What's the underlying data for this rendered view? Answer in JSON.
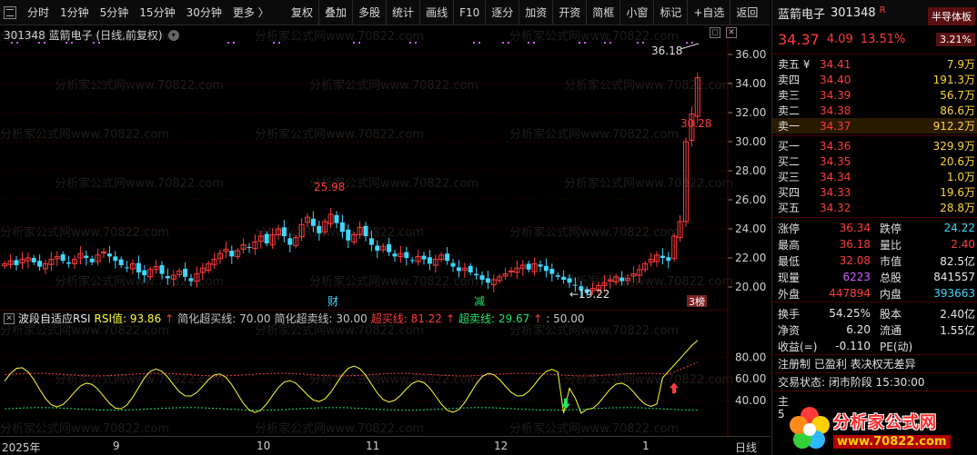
{
  "toolbar": {
    "left": [
      "分时",
      "1分钟",
      "5分钟",
      "15分钟",
      "30分钟",
      "更多 〉"
    ],
    "right": [
      "复权",
      "叠加",
      "多股",
      "统计",
      "画线",
      "F10",
      "逐分",
      "加资",
      "开资",
      "简框",
      "小窗",
      "标记",
      "+自选",
      "返回"
    ]
  },
  "chart": {
    "title": "301348 蓝箭电子 (日线,前复权)",
    "y_ticks": [
      "36.00",
      "34.00",
      "32.00",
      "30.00",
      "28.00",
      "26.00",
      "24.00",
      "22.00",
      "20.00"
    ],
    "annotations": {
      "high": "36.18",
      "peak2": "30.28",
      "mid": "25.98",
      "low": "←19.22"
    },
    "events": {
      "cai": "财",
      "jian": "减",
      "bang": "3榜"
    },
    "watermark": "分析家公式网www.70822.com"
  },
  "indicator": {
    "name": "波段自适应RSI",
    "rsi_label": "RSI值: 93.86",
    "simp_over_buy": "简化超买线: 70.00",
    "simp_over_sell": "简化超卖线: 30.00",
    "over_buy": "超买线: 81.22",
    "over_sell": "超卖线: 29.67",
    "mid": ": 50.00",
    "y_ticks": [
      "80.00",
      "60.00",
      "40.00"
    ]
  },
  "xaxis": {
    "labels": [
      "2025年",
      "9",
      "10",
      "11",
      "12",
      "1"
    ],
    "period": "日线"
  },
  "chart_data": {
    "type": "candlestick",
    "ylim": [
      19,
      37
    ],
    "closes": [
      21.6,
      21.8,
      21.5,
      21.9,
      22.0,
      21.7,
      21.4,
      21.6,
      21.9,
      22.1,
      21.8,
      21.6,
      21.9,
      22.3,
      22.0,
      21.7,
      22.2,
      22.4,
      22.1,
      21.8,
      21.5,
      21.3,
      21.6,
      21.0,
      20.8,
      21.2,
      21.4,
      20.9,
      20.6,
      20.8,
      21.1,
      20.7,
      20.4,
      20.9,
      21.3,
      21.6,
      21.9,
      22.3,
      22.6,
      22.1,
      22.5,
      22.9,
      22.7,
      23.1,
      23.5,
      23.0,
      23.6,
      24.0,
      23.5,
      22.9,
      23.4,
      24.3,
      24.8,
      24.2,
      23.7,
      24.5,
      25.0,
      24.4,
      23.8,
      23.2,
      23.6,
      24.1,
      23.5,
      22.9,
      22.5,
      22.8,
      22.4,
      22.1,
      22.3,
      22.0,
      21.8,
      22.1,
      21.9,
      21.6,
      21.9,
      22.2,
      21.8,
      21.4,
      21.1,
      21.3,
      21.0,
      20.8,
      20.5,
      20.3,
      20.5,
      20.7,
      20.9,
      21.1,
      21.3,
      21.5,
      21.2,
      21.6,
      21.4,
      21.1,
      20.9,
      20.7,
      20.5,
      20.3,
      20.1,
      19.8,
      19.6,
      19.9,
      20.1,
      20.3,
      20.5,
      20.7,
      20.4,
      20.6,
      20.9,
      21.2,
      21.6,
      21.9,
      22.2,
      22.0,
      21.8,
      23.5,
      24.5,
      30.0,
      31.9,
      34.4
    ]
  },
  "quote": {
    "name": "蓝箭电子",
    "code": "301348",
    "r": "R",
    "tag": "半导体板",
    "price": "34.37",
    "change": "4.09",
    "pct": "13.51%",
    "pct_tag": "3.21%"
  },
  "orderbook": {
    "asks": [
      {
        "label": "卖五 ¥",
        "price": "34.41",
        "vol": "7.9万"
      },
      {
        "label": "卖四",
        "price": "34.40",
        "vol": "191.3万"
      },
      {
        "label": "卖三",
        "price": "34.39",
        "vol": "56.7万"
      },
      {
        "label": "卖二",
        "price": "34.38",
        "vol": "86.6万"
      },
      {
        "label": "卖一",
        "price": "34.37",
        "vol": "912.2万"
      }
    ],
    "bids": [
      {
        "label": "买一",
        "price": "34.36",
        "vol": "329.9万"
      },
      {
        "label": "买二",
        "price": "34.35",
        "vol": "20.6万"
      },
      {
        "label": "买三",
        "price": "34.34",
        "vol": "1.0万"
      },
      {
        "label": "买四",
        "price": "34.33",
        "vol": "19.6万"
      },
      {
        "label": "买五",
        "price": "34.32",
        "vol": "28.8万"
      }
    ]
  },
  "stats": [
    {
      "k": "涨停",
      "v": "36.34",
      "vc": "red",
      "k2": "跌停",
      "v2": "24.22",
      "v2c": "cyan"
    },
    {
      "k": "最高",
      "v": "36.18",
      "vc": "red",
      "k2": "量比",
      "v2": "2.40",
      "v2c": "red"
    },
    {
      "k": "最低",
      "v": "32.08",
      "vc": "red",
      "k2": "市值",
      "v2": "82.5亿",
      "v2c": "white"
    },
    {
      "k": "现量",
      "v": "6223",
      "vc": "mag",
      "k2": "总股",
      "v2": "841557",
      "v2c": "white"
    },
    {
      "k": "外盘",
      "v": "447894",
      "vc": "red",
      "k2": "内盘",
      "v2": "393663",
      "v2c": "cyan"
    }
  ],
  "stats2": [
    {
      "k": "换手",
      "v": "54.25%",
      "vc": "white",
      "k2": "股本",
      "v2": "2.40亿",
      "v2c": "white"
    },
    {
      "k": "净资",
      "v": "6.20",
      "vc": "white",
      "k2": "流通",
      "v2": "1.55亿",
      "v2c": "white"
    },
    {
      "k": "收益(=)",
      "v": "-0.110",
      "vc": "white",
      "k2": "PE(动)",
      "v2": "",
      "v2c": "white"
    }
  ],
  "notes": {
    "n1": "注册制 已盈利 表决权无差异",
    "n2": "交易状态: 闭市阶段 15:30:00"
  },
  "mini": {
    "a": "主",
    "b": "5"
  },
  "logo": {
    "cn": "分析家公式网",
    "url": "www.70822.com"
  },
  "colors": {
    "up": "#ff3b3b",
    "down": "#3fd7ff",
    "rsi": "#ffff33",
    "overbuy": "#ff3b3b",
    "oversell": "#22e36b"
  }
}
